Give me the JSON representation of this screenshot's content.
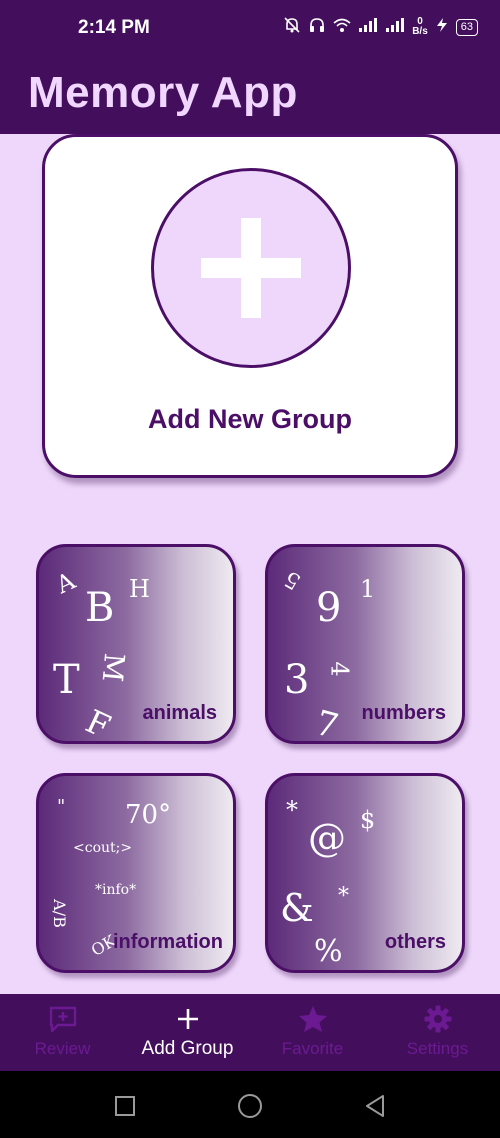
{
  "status_bar": {
    "time": "2:14 PM",
    "net_speed_value": "0",
    "net_speed_unit": "B/s",
    "battery": "63",
    "icons": [
      "mute-bell-icon",
      "headphones-icon",
      "wifi-icon",
      "signal-icon",
      "signal-icon",
      "charging-icon"
    ]
  },
  "app": {
    "title": "Memory App"
  },
  "add_group": {
    "label": "Add New Group",
    "icon": "plus-icon"
  },
  "groups": [
    {
      "label": "animals",
      "glyphs": [
        "A",
        "B",
        "H",
        "T",
        "M",
        "F"
      ]
    },
    {
      "label": "numbers",
      "glyphs": [
        "5",
        "9",
        "1",
        "3",
        "4",
        "7"
      ]
    },
    {
      "label": "information",
      "glyphs": [
        "\"",
        "70°",
        "<cout;>",
        "*info*",
        "A/B",
        "OK"
      ]
    },
    {
      "label": "others",
      "glyphs": [
        "*",
        "@",
        "$",
        "&",
        "*",
        "%"
      ]
    }
  ],
  "bottom_nav": [
    {
      "label": "Review",
      "icon": "review-icon",
      "active": false
    },
    {
      "label": "Add Group",
      "icon": "plus-icon",
      "active": true
    },
    {
      "label": "Favorite",
      "icon": "star-icon",
      "active": false
    },
    {
      "label": "Settings",
      "icon": "gear-icon",
      "active": false
    }
  ],
  "colors": {
    "primary_dark": "#430f5c",
    "accent": "#4b0f67",
    "background": "#efd7fb",
    "title_text": "#f1d6ff",
    "inactive_nav": "#6b1a92"
  }
}
